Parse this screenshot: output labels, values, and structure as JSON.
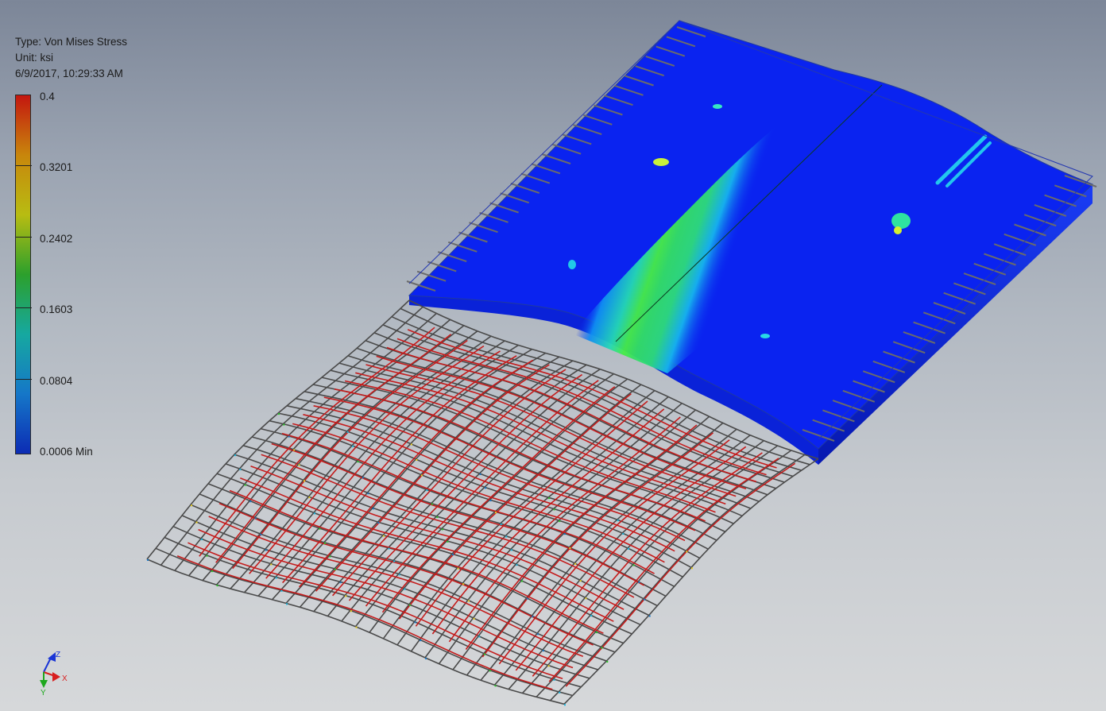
{
  "legend": {
    "type_line": "Type: Von Mises Stress",
    "unit_line": "Unit: ksi",
    "timestamp": "6/9/2017, 10:29:33 AM",
    "ticks": [
      "0.4",
      "0.3201",
      "0.2402",
      "0.1603",
      "0.0804",
      "0.0006 Min"
    ],
    "colors": [
      "#c4160f",
      "#c8860c",
      "#b8bc12",
      "#2ca02c",
      "#16a8a0",
      "#1577c8",
      "#0c2cb4"
    ]
  },
  "view_cube": {
    "z_label": "Z",
    "x_label": "X",
    "y_label": "Y",
    "z_color": "#1a35d6",
    "x_color": "#d81f1f",
    "y_color": "#1ea81e"
  },
  "model": {
    "slab_color": "#0a23f0",
    "band_color": "#35e35a",
    "rebar_color": "#c41c1c",
    "mesh_color": "#4a4a4a"
  }
}
